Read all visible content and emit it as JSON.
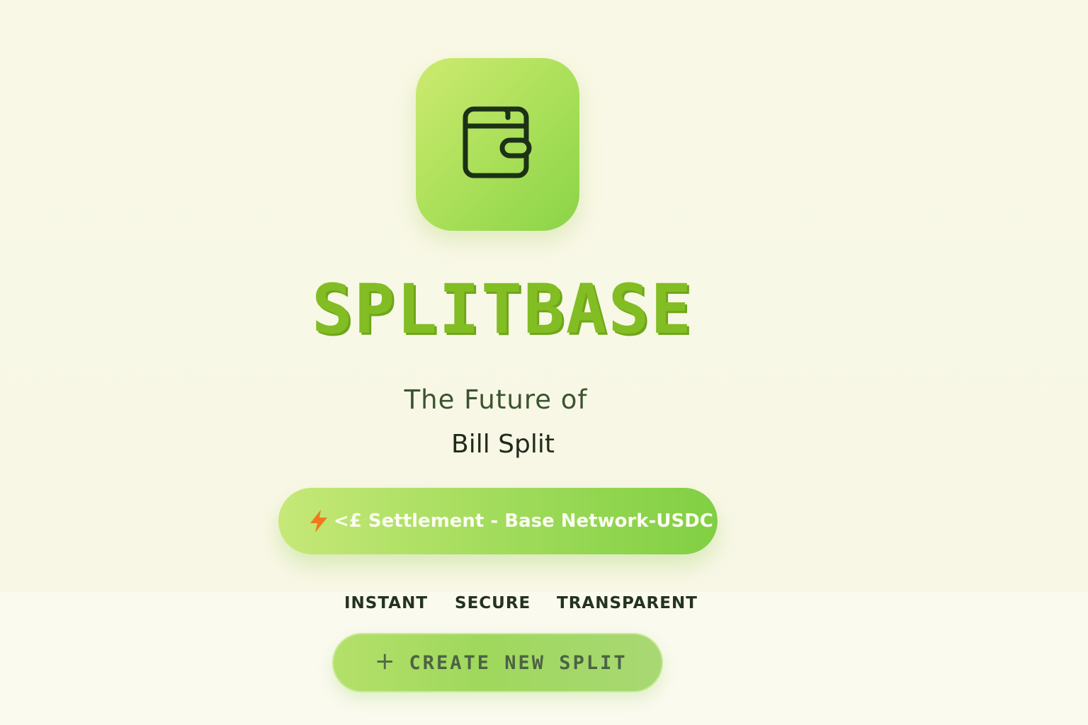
{
  "brand": {
    "title": "SPLITBASE",
    "icon": "wallet-icon"
  },
  "tagline": {
    "line1": "The Future of",
    "line2": "Bill Split"
  },
  "settlement": {
    "icon": "lightning-bolt-icon",
    "text": "<£ Settlement - Base Network-USDC"
  },
  "features": [
    "INSTANT",
    "SECURE",
    "TRANSPARENT"
  ],
  "cta": {
    "icon": "plus-icon",
    "label": "CREATE NEW SPLIT"
  },
  "colors": {
    "accent": "#82bd24",
    "pill_start": "#c6e877",
    "pill_end": "#80cf43",
    "background": "#f9f8e8",
    "text_dark": "#23331f"
  }
}
